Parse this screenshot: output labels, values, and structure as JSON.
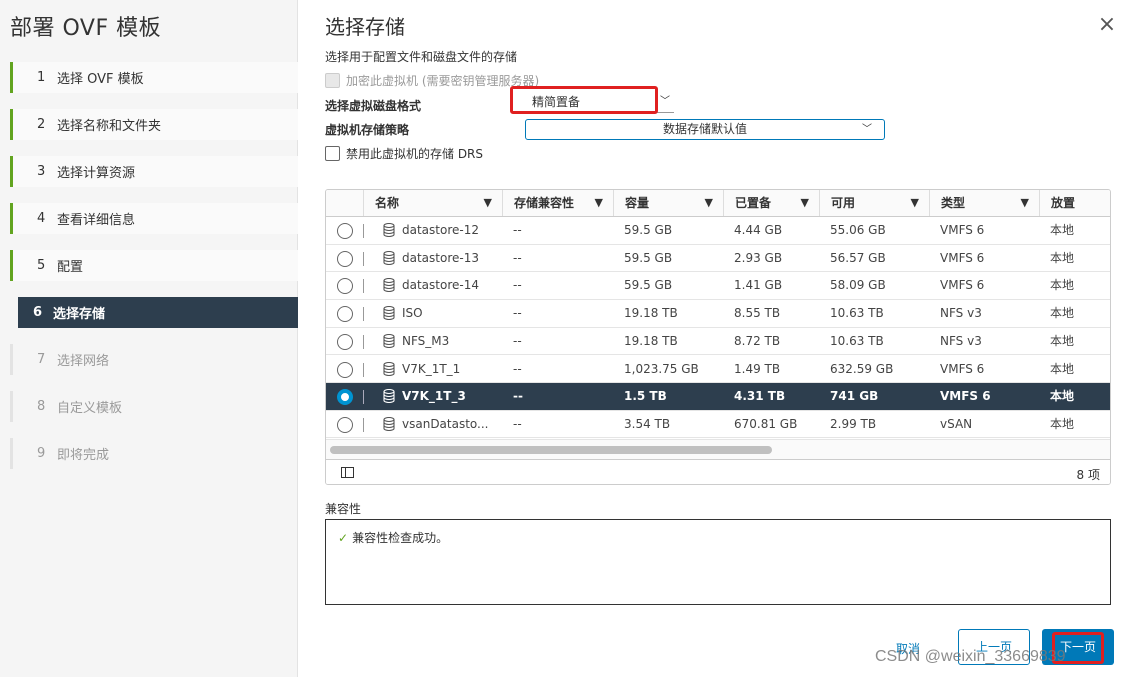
{
  "wizard": {
    "title": "部署 OVF 模板",
    "steps": [
      {
        "num": "1",
        "label": "选择 OVF 模板",
        "state": "done"
      },
      {
        "num": "2",
        "label": "选择名称和文件夹",
        "state": "done"
      },
      {
        "num": "3",
        "label": "选择计算资源",
        "state": "done"
      },
      {
        "num": "4",
        "label": "查看详细信息",
        "state": "done"
      },
      {
        "num": "5",
        "label": "配置",
        "state": "done"
      },
      {
        "num": "6",
        "label": "选择存储",
        "state": "active"
      },
      {
        "num": "7",
        "label": "选择网络",
        "state": "pending"
      },
      {
        "num": "8",
        "label": "自定义模板",
        "state": "pending"
      },
      {
        "num": "9",
        "label": "即将完成",
        "state": "pending"
      }
    ]
  },
  "page": {
    "title": "选择存储",
    "subtitle": "选择用于配置文件和磁盘文件的存储",
    "close_icon": "×"
  },
  "options": {
    "encrypt_label": "加密此虚拟机 (需要密钥管理服务器)",
    "disk_format_label": "选择虚拟磁盘格式",
    "disk_format_value": "精简置备",
    "policy_label": "虚拟机存储策略",
    "policy_value": "数据存储默认值",
    "drs_label": "禁用此虚拟机的存储 DRS"
  },
  "grid": {
    "columns": [
      "名称",
      "存储兼容性",
      "容量",
      "已置备",
      "可用",
      "类型",
      "放置"
    ],
    "rows": [
      {
        "name": "datastore-12",
        "compat": "--",
        "capacity": "59.5 GB",
        "provisioned": "4.44 GB",
        "free": "55.06 GB",
        "type": "VMFS 6",
        "placement": "本地",
        "selected": false
      },
      {
        "name": "datastore-13",
        "compat": "--",
        "capacity": "59.5 GB",
        "provisioned": "2.93 GB",
        "free": "56.57 GB",
        "type": "VMFS 6",
        "placement": "本地",
        "selected": false
      },
      {
        "name": "datastore-14",
        "compat": "--",
        "capacity": "59.5 GB",
        "provisioned": "1.41 GB",
        "free": "58.09 GB",
        "type": "VMFS 6",
        "placement": "本地",
        "selected": false
      },
      {
        "name": "ISO",
        "compat": "--",
        "capacity": "19.18 TB",
        "provisioned": "8.55 TB",
        "free": "10.63 TB",
        "type": "NFS v3",
        "placement": "本地",
        "selected": false
      },
      {
        "name": "NFS_M3",
        "compat": "--",
        "capacity": "19.18 TB",
        "provisioned": "8.72 TB",
        "free": "10.63 TB",
        "type": "NFS v3",
        "placement": "本地",
        "selected": false
      },
      {
        "name": "V7K_1T_1",
        "compat": "--",
        "capacity": "1,023.75 GB",
        "provisioned": "1.49 TB",
        "free": "632.59 GB",
        "type": "VMFS 6",
        "placement": "本地",
        "selected": false
      },
      {
        "name": "V7K_1T_3",
        "compat": "--",
        "capacity": "1.5 TB",
        "provisioned": "4.31 TB",
        "free": "741 GB",
        "type": "VMFS 6",
        "placement": "本地",
        "selected": true
      },
      {
        "name": "vsanDatasto...",
        "compat": "--",
        "capacity": "3.54 TB",
        "provisioned": "670.81 GB",
        "free": "2.99 TB",
        "type": "vSAN",
        "placement": "本地",
        "selected": false
      }
    ],
    "count": "8 项"
  },
  "compatibility": {
    "label": "兼容性",
    "message": "兼容性检查成功。"
  },
  "buttons": {
    "cancel": "取消",
    "back": "上一页",
    "next": "下一页"
  },
  "watermark": "CSDN @weixin_33669839",
  "colors": {
    "accent": "#0079b8",
    "selected_row": "#2d3e4e",
    "done_step": "#62a420",
    "highlight_box": "#e02020"
  }
}
